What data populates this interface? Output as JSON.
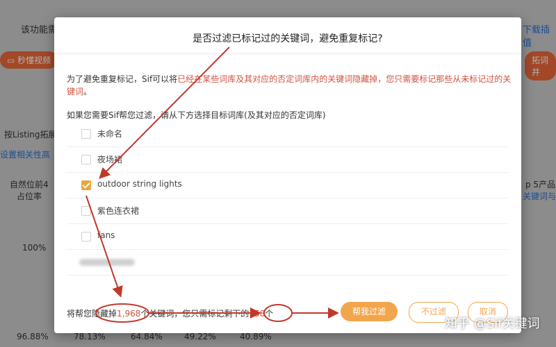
{
  "background": {
    "left_label": "该功能需",
    "right_link": "下载插值",
    "pill_left": "秒懂视频",
    "pill_right": "拓词并",
    "listing_label": "按Listing拓展",
    "setting_link": "设置相关性高",
    "col1_a": "自然位前4",
    "col1_b": "占位率",
    "pct_mid": "100%",
    "top5": "p 5产品",
    "top5_link": "关键词与",
    "row_pcts": [
      "96.88%",
      "78.13%",
      "64.84%",
      "49.22%",
      "40.89%"
    ]
  },
  "modal": {
    "title": "是否过滤已标记过的关键词，避免重复标记?",
    "desc_prefix": "为了避免重复标记，Sif可以将",
    "desc_highlight": "已经在某些词库及其对应的否定词库内的关键词隐藏掉，您只需要标记那些从未标记过的关键词",
    "desc_suffix": "。",
    "sub_label": "如果您需要Sif帮您过滤，请从下方选择目标词库(及其对应的否定词库)",
    "items": [
      {
        "label": "未命名",
        "checked": false
      },
      {
        "label": "夜场裙",
        "checked": false
      },
      {
        "label": "outdoor string lights",
        "checked": true
      },
      {
        "label": "紫色连衣裙",
        "checked": false
      },
      {
        "label": "fans",
        "checked": false
      }
    ],
    "footer_prefix": "将帮您隐藏掉",
    "hidden_count": "1,968",
    "footer_mid": "个关键词，您只需标记剩下的",
    "remaining_count": "358",
    "footer_suffix": "个",
    "btn_filter": "帮我过滤",
    "btn_nofilter": "不过滤",
    "btn_cancel": "取消"
  },
  "watermark": "知乎 @Sif关键词",
  "colors": {
    "accent": "#f2a64b",
    "highlight": "#d0533f",
    "annotation": "#c0392b"
  }
}
